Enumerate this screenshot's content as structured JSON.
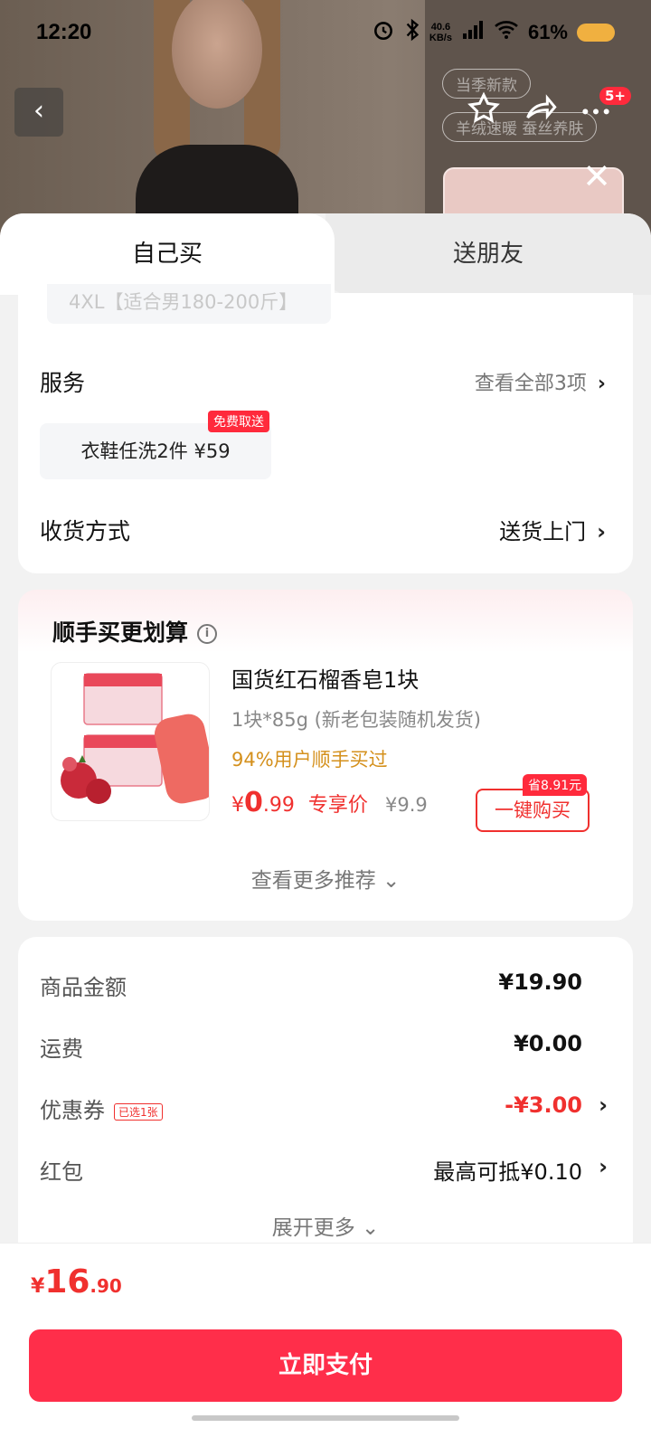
{
  "status": {
    "time": "12:20",
    "net_speed_top": "40.6",
    "net_speed_bottom": "KB/s",
    "battery": "61%"
  },
  "bg": {
    "tag1": "当季新款",
    "tag2": "羊绒速暖 蚕丝养肤",
    "badge": "5+"
  },
  "tabs": {
    "self": "自己买",
    "friend": "送朋友"
  },
  "size_chip": "4XL【适合男180-200斤】",
  "service": {
    "title": "服务",
    "view_all": "查看全部3项",
    "chip": "衣鞋任洗2件  ¥59",
    "free_tag": "免费取送"
  },
  "delivery": {
    "title": "收货方式",
    "value": "送货上门"
  },
  "addon": {
    "title": "顺手买更划算",
    "product_name": "国货红石榴香皂1块",
    "spec": "1块*85g (新老包装随机发货)",
    "stat": "94%用户顺手买过",
    "price_symbol": "¥",
    "price_int": "0",
    "price_dec": ".99",
    "price_label": "专享价",
    "orig_price": "¥9.9",
    "save_tag": "省8.91元",
    "buy_button": "一键购买",
    "more": "查看更多推荐"
  },
  "summary": {
    "goods_label": "商品金额",
    "goods_value": "¥19.90",
    "ship_label": "运费",
    "ship_value": "¥0.00",
    "coupon_label": "优惠券",
    "coupon_tag": "已选1张",
    "coupon_value": "-¥3.00",
    "redpacket_label": "红包",
    "redpacket_value": "最高可抵¥0.10",
    "expand": "展开更多"
  },
  "bottom": {
    "symbol": "¥",
    "int": "16",
    "dec": ".90",
    "pay": "立即支付"
  },
  "colors": {
    "accent": "#f0302e",
    "pay_button": "#ff2e4a",
    "stat": "#d4901c"
  }
}
